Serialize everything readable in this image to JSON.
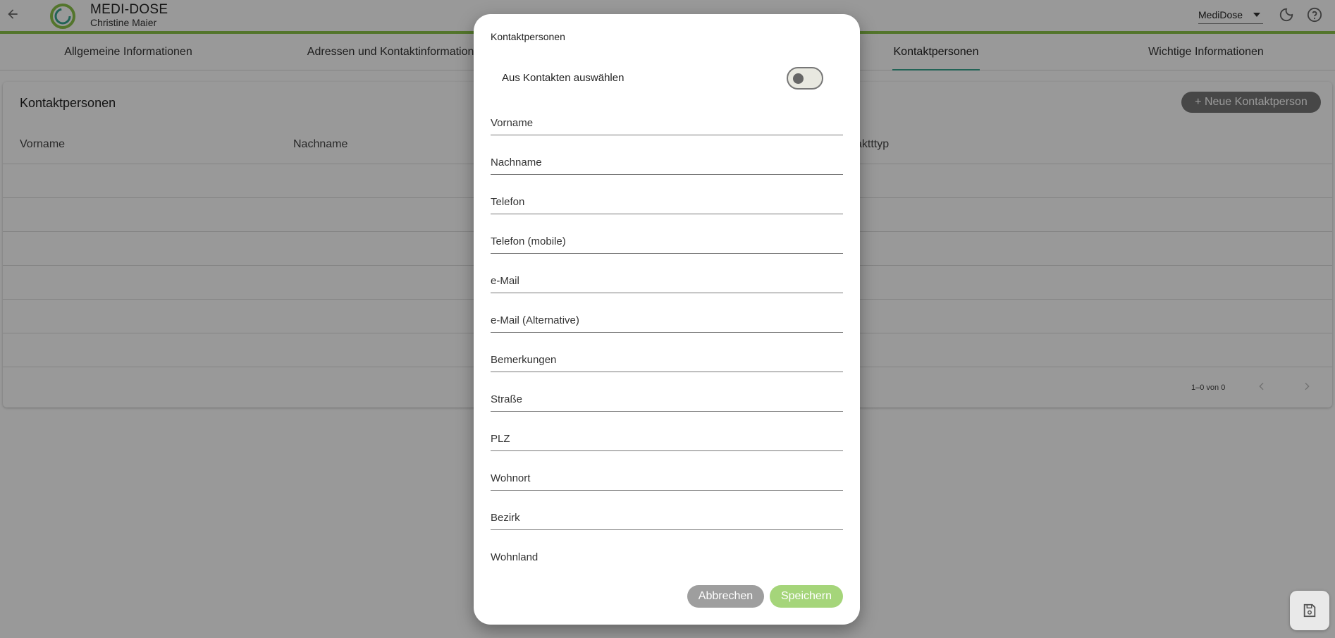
{
  "header": {
    "app_title": "MEDI-DOSE",
    "user_name": "Christine Maier",
    "organization": "MediDose",
    "accent_color": "#8bc34a"
  },
  "tabs": [
    {
      "label": "Allgemeine Informationen",
      "active": false
    },
    {
      "label": "Adressen und Kontaktinformationen",
      "active": false
    },
    {
      "label": "Kontaktpersonen",
      "active": true
    },
    {
      "label": "Wichtige Informationen",
      "active": false
    }
  ],
  "card": {
    "title": "Kontaktpersonen",
    "new_button_label": "Neue Kontaktperson",
    "columns": [
      "Vorname",
      "Nachname",
      "aktttyp"
    ],
    "paginator": "1–0 von 0"
  },
  "dialog": {
    "title": "Kontaktpersonen",
    "toggle_label": "Aus Kontakten auswählen",
    "toggle_checked": false,
    "fields": [
      {
        "label": "Vorname",
        "value": ""
      },
      {
        "label": "Nachname",
        "value": ""
      },
      {
        "label": "Telefon",
        "value": ""
      },
      {
        "label": "Telefon (mobile)",
        "value": ""
      },
      {
        "label": "e-Mail",
        "value": ""
      },
      {
        "label": "e-Mail (Alternative)",
        "value": ""
      },
      {
        "label": "Bemerkungen",
        "value": ""
      },
      {
        "label": "Straße",
        "value": ""
      },
      {
        "label": "PLZ",
        "value": ""
      },
      {
        "label": "Wohnort",
        "value": ""
      },
      {
        "label": "Bezirk",
        "value": ""
      },
      {
        "label": "Wohnland",
        "value": ""
      }
    ],
    "cancel_label": "Abbrechen",
    "save_label": "Speichern",
    "save_color": "#a5d57a"
  },
  "icons": {
    "back": "arrow-back-icon",
    "theme": "moon-icon",
    "help": "help-icon",
    "save_fab": "floppy-disk-icon"
  }
}
